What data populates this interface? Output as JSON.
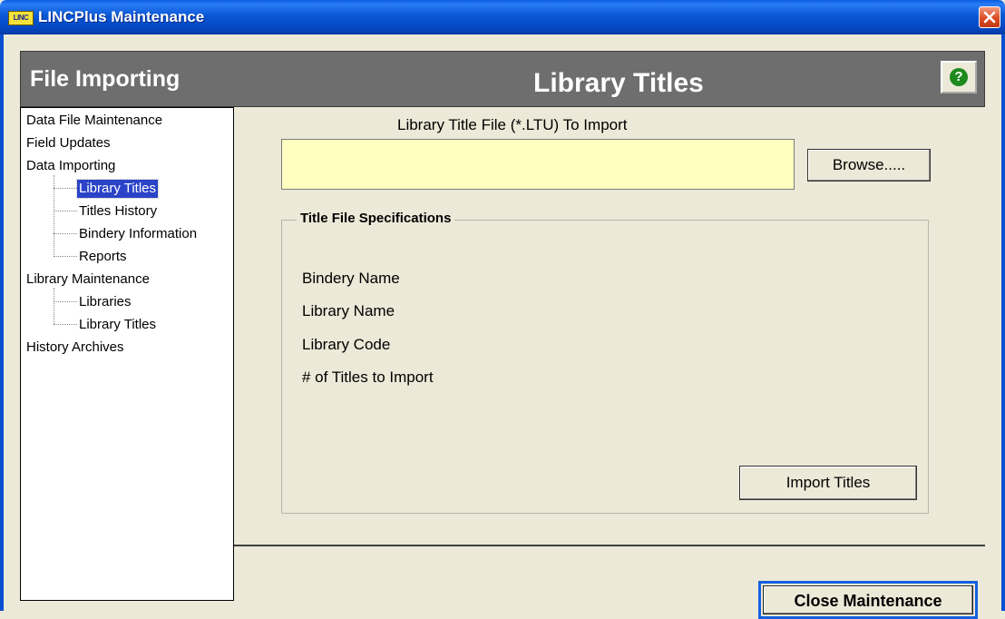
{
  "window": {
    "title": "LINCPlus Maintenance",
    "logo_text": "LINC"
  },
  "header": {
    "section": "File Importing",
    "page_title": "Library Titles",
    "help_symbol": "?"
  },
  "tree": {
    "items": [
      {
        "label": "Data File Maintenance"
      },
      {
        "label": "Field Updates"
      },
      {
        "label": "Data Importing"
      },
      {
        "label": "Library Titles",
        "selected": true
      },
      {
        "label": "Titles History"
      },
      {
        "label": "Bindery Information"
      },
      {
        "label": "Reports"
      },
      {
        "label": "Library Maintenance"
      },
      {
        "label": "Libraries"
      },
      {
        "label": "Library Titles"
      },
      {
        "label": "History Archives"
      }
    ]
  },
  "import": {
    "file_label": "Library Title File (*.LTU) To Import",
    "file_value": "",
    "browse_label": "Browse.....",
    "group_title": "Title File Specifications",
    "specs": [
      "Bindery Name",
      "Library Name",
      "Library Code",
      "# of Titles to Import"
    ],
    "import_button": "Import Titles"
  },
  "footer": {
    "close_button": "Close Maintenance"
  },
  "colors": {
    "titlebar": "#0a57d6",
    "header": "#6e6e6e",
    "input_bg": "#ffffc0",
    "selected": "#2a43c7"
  }
}
